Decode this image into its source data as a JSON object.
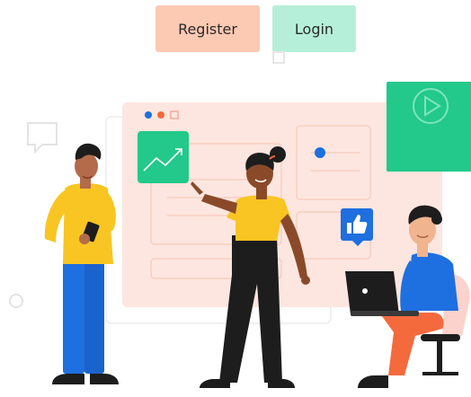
{
  "header": {
    "register_label": "Register",
    "login_label": "Login"
  },
  "colors": {
    "register_bg": "#fcc9b3",
    "login_bg": "#b6efd9",
    "panel_bg": "#fde6df",
    "accent_green": "#22c98b",
    "accent_blue": "#1e6fe0",
    "accent_yellow": "#f8c522"
  },
  "illustration": {
    "icons": [
      "chart-trend-icon",
      "play-icon",
      "thumbs-up-icon",
      "chat-bubble-icon"
    ]
  }
}
